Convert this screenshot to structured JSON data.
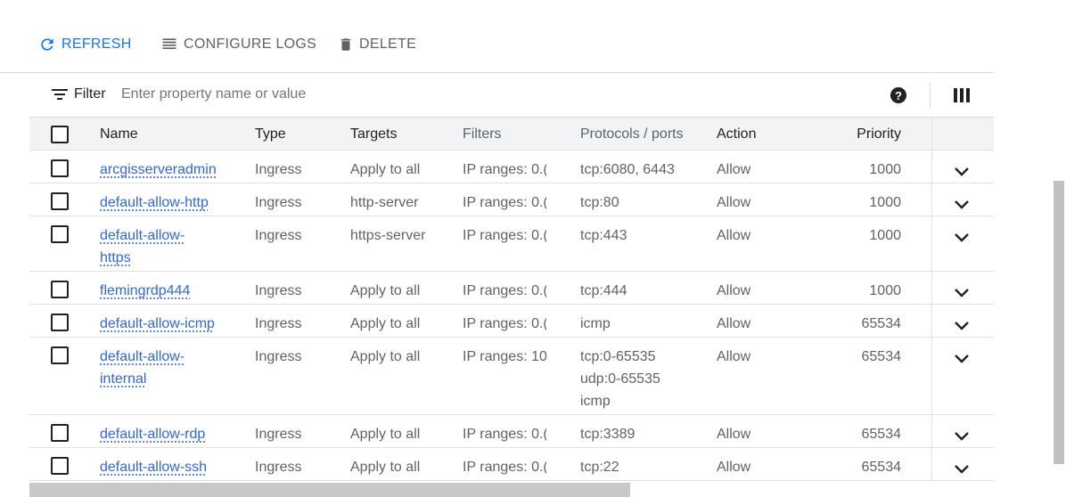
{
  "toolbar": {
    "refresh_label": "REFRESH",
    "configure_logs_label": "CONFIGURE LOGS",
    "delete_label": "DELETE"
  },
  "filter": {
    "label": "Filter",
    "placeholder": "Enter property name or value"
  },
  "columns": {
    "name": "Name",
    "type": "Type",
    "targets": "Targets",
    "filters": "Filters",
    "ports": "Protocols / ports",
    "action": "Action",
    "priority": "Priority"
  },
  "rows": [
    {
      "name_lines": [
        "arcgisserveradmin"
      ],
      "type": "Ingress",
      "targets": "Apply to all",
      "filters": "IP ranges: 0.(",
      "ports": [
        "tcp:6080, 6443"
      ],
      "action": "Allow",
      "priority": "1000"
    },
    {
      "name_lines": [
        "default-allow-http"
      ],
      "type": "Ingress",
      "targets": "http-server",
      "filters": "IP ranges: 0.(",
      "ports": [
        "tcp:80"
      ],
      "action": "Allow",
      "priority": "1000"
    },
    {
      "name_lines": [
        "default-allow-",
        "https"
      ],
      "type": "Ingress",
      "targets": "https-server",
      "filters": "IP ranges: 0.(",
      "ports": [
        "tcp:443"
      ],
      "action": "Allow",
      "priority": "1000"
    },
    {
      "name_lines": [
        "flemingrdp444"
      ],
      "type": "Ingress",
      "targets": "Apply to all",
      "filters": "IP ranges: 0.(",
      "ports": [
        "tcp:444"
      ],
      "action": "Allow",
      "priority": "1000"
    },
    {
      "name_lines": [
        "default-allow-icmp"
      ],
      "type": "Ingress",
      "targets": "Apply to all",
      "filters": "IP ranges: 0.(",
      "ports": [
        "icmp"
      ],
      "action": "Allow",
      "priority": "65534"
    },
    {
      "name_lines": [
        "default-allow-",
        "internal"
      ],
      "type": "Ingress",
      "targets": "Apply to all",
      "filters": "IP ranges: 10",
      "ports": [
        "tcp:0-65535",
        "udp:0-65535",
        "icmp"
      ],
      "action": "Allow",
      "priority": "65534"
    },
    {
      "name_lines": [
        "default-allow-rdp"
      ],
      "type": "Ingress",
      "targets": "Apply to all",
      "filters": "IP ranges: 0.(",
      "ports": [
        "tcp:3389"
      ],
      "action": "Allow",
      "priority": "65534"
    },
    {
      "name_lines": [
        "default-allow-ssh"
      ],
      "type": "Ingress",
      "targets": "Apply to all",
      "filters": "IP ranges: 0.(",
      "ports": [
        "tcp:22"
      ],
      "action": "Allow",
      "priority": "65534"
    }
  ]
}
